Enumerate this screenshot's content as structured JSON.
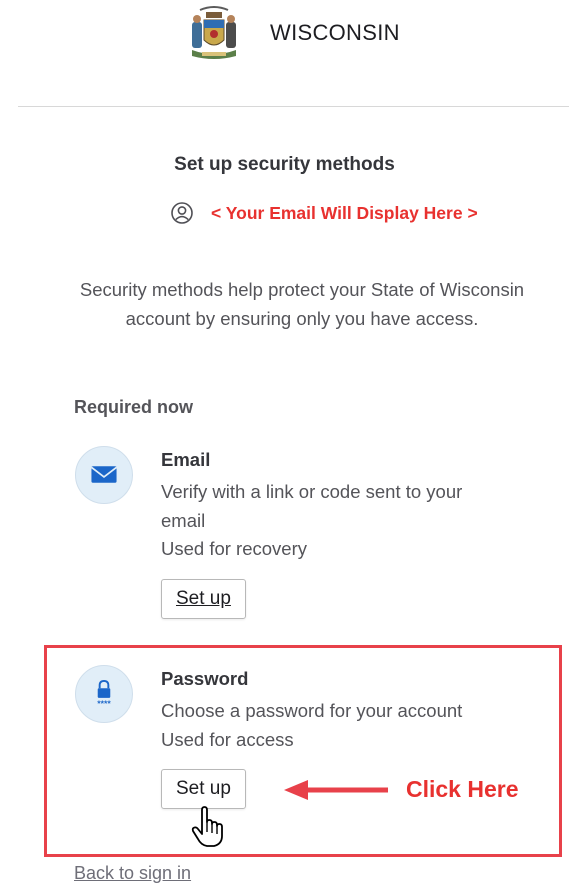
{
  "header": {
    "seal_text": "STATE OF WISCONSIN",
    "brand": "WISCONSIN"
  },
  "page": {
    "title": "Set up security methods",
    "email_placeholder_note": "< Your Email Will Display Here >",
    "intro": "Security methods help protect your State of Wisconsin account by ensuring only you have access.",
    "section_label": "Required now"
  },
  "methods": [
    {
      "name": "Email",
      "desc_lines": [
        "Verify with a link or code sent to your",
        "email",
        "Used for recovery"
      ],
      "button": "Set up",
      "icon": "envelope-icon"
    },
    {
      "name": "Password",
      "desc_lines": [
        "Choose a password for your account",
        "Used for access"
      ],
      "button": "Set up",
      "icon": "password-lock-icon",
      "icon_text": "****"
    }
  ],
  "annotation": {
    "callout": "Click Here",
    "color": "#e8312f"
  },
  "footer": {
    "back_link": "Back to sign in"
  },
  "colors": {
    "accent_red": "#e8414a",
    "icon_blue": "#1b66c9",
    "icon_bg": "#e1eef8"
  }
}
